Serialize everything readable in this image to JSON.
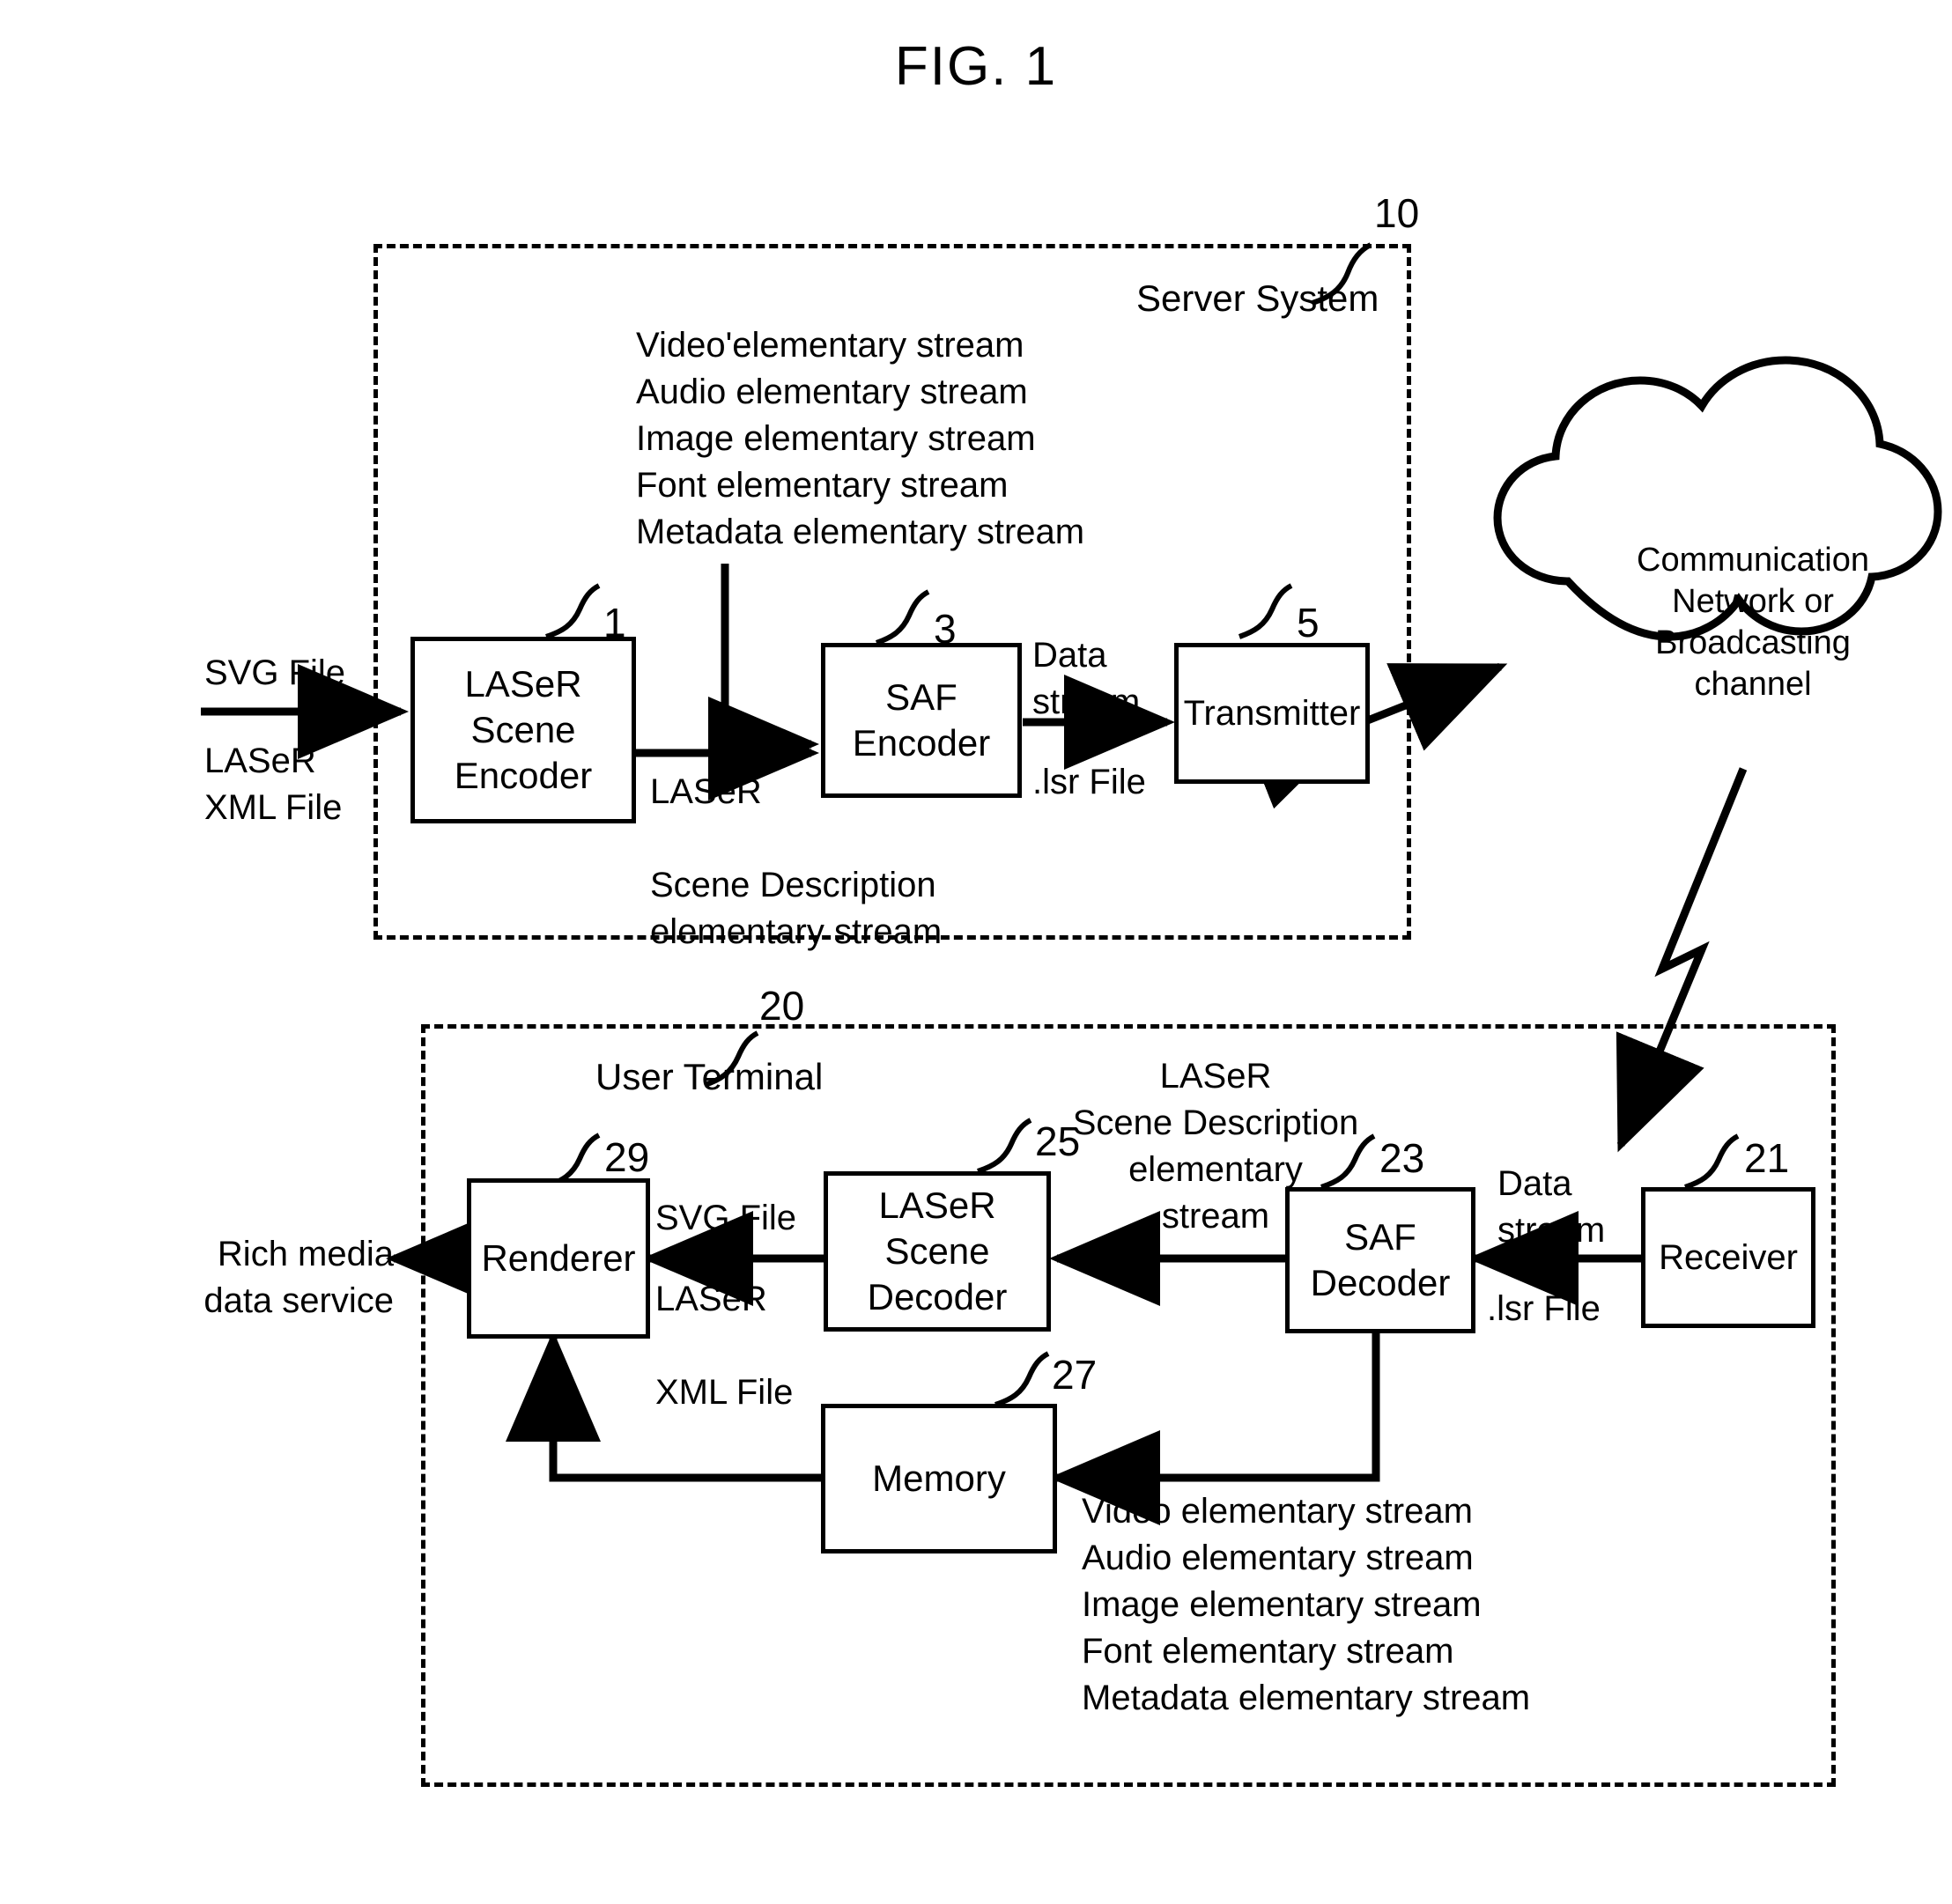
{
  "figure": {
    "title": "FIG. 1"
  },
  "server": {
    "ref": "10",
    "label": "Server System",
    "streams": [
      "Video'elementary stream",
      "Audio elementary stream",
      "Image elementary stream",
      "Font elementary stream",
      "Metadata elementary stream"
    ],
    "input_labels": {
      "svg_file": "SVG File",
      "laser_xml_file": "LASeR\nXML File"
    },
    "blocks": [
      {
        "ref": "1",
        "label": "LASeR\nScene\nEncoder",
        "name": "laser-scene-encoder"
      },
      {
        "ref": "3",
        "label": "SAF\nEncoder",
        "name": "saf-encoder"
      },
      {
        "ref": "5",
        "label": "Transmitter",
        "name": "transmitter"
      }
    ],
    "edge_labels": {
      "scene_description": "LASeR\n\nScene Description\nelementary stream",
      "data_stream": "Data\nstream",
      "lsr_file": ".lsr File"
    }
  },
  "cloud": {
    "label": "Communication\nNetwork or\nBroadcasting\nchannel"
  },
  "terminal": {
    "ref": "20",
    "label": "User Terminal",
    "streams": [
      "Video elementary stream",
      "Audio elementary stream",
      "Image elementary stream",
      "Font elementary stream",
      "Metadata elementary stream"
    ],
    "output_label": "Rich media\ndata service",
    "blocks": [
      {
        "ref": "29",
        "label": "Renderer",
        "name": "renderer"
      },
      {
        "ref": "25",
        "label": "LASeR\nScene\nDecoder",
        "name": "laser-scene-decoder"
      },
      {
        "ref": "27",
        "label": "Memory",
        "name": "memory"
      },
      {
        "ref": "23",
        "label": "SAF\nDecoder",
        "name": "saf-decoder"
      },
      {
        "ref": "21",
        "label": "Receiver",
        "name": "receiver"
      }
    ],
    "edge_labels": {
      "svg_file": "SVG File",
      "laser_xml_file": "LASeR\n\nXML File",
      "scene_description": "LASeR\nScene Description\nelementary\nstream",
      "data_stream": "Data\nstream",
      "lsr_file": ".lsr File"
    }
  },
  "colors": {
    "ink": "#000000",
    "paper": "#ffffff"
  }
}
